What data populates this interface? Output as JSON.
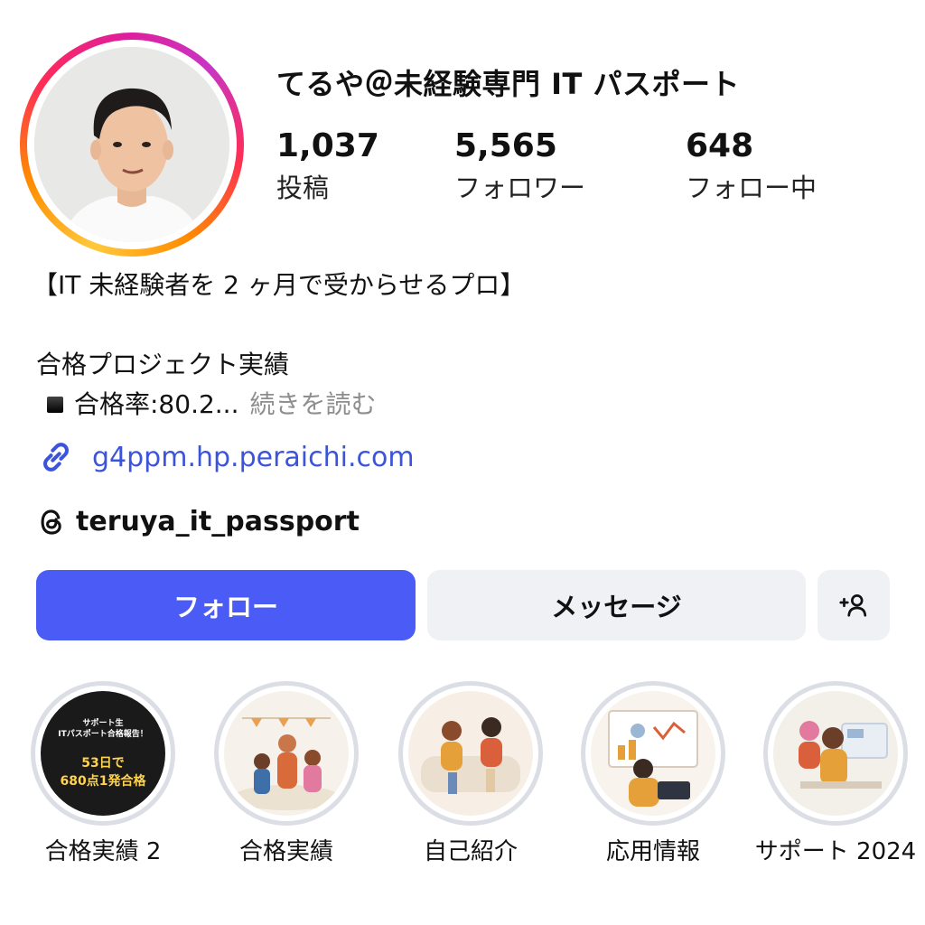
{
  "profile": {
    "username": "てるや＠未経験専門 IT パスポート",
    "avatar_icon": "profile-photo",
    "ring_colors": [
      "#ffc93c",
      "#ff8a00",
      "#ff2d55",
      "#e11d9a"
    ]
  },
  "stats": {
    "posts": {
      "value": "1,037",
      "label": "投稿"
    },
    "followers": {
      "value": "5,565",
      "label": "フォロワー"
    },
    "following": {
      "value": "648",
      "label": "フォロー中"
    }
  },
  "bio": {
    "line1": "【IT 未経験者を 2 ヶ月で受からせるプロ】",
    "line2": "合格プロジェクト実績",
    "line3": "合格率:80.2...",
    "more": "続きを読む"
  },
  "link": {
    "text": "g4ppm.hp.peraichi.com",
    "icon": "link-icon",
    "color": "#3b54d9"
  },
  "threads": {
    "handle": "teruya_it_passport",
    "icon": "threads-icon"
  },
  "actions": {
    "follow_label": "フォロー",
    "message_label": "メッセージ",
    "add_user_icon": "add-user-icon",
    "follow_color": "#4a5cf5"
  },
  "highlights": [
    {
      "label": "合格実績 2",
      "cover_text": [
        "サポート生",
        "ITパスポート合格報告！",
        "53日で",
        "680点1発合格"
      ]
    },
    {
      "label": "合格実績"
    },
    {
      "label": "自己紹介"
    },
    {
      "label": "応用情報"
    },
    {
      "label": "サポート 2024"
    }
  ]
}
